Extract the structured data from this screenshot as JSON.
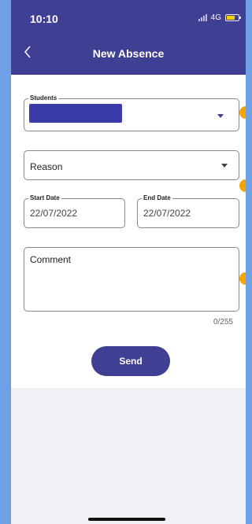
{
  "status_bar": {
    "time": "10:10",
    "network": "4G"
  },
  "header": {
    "title": "New Absence"
  },
  "form": {
    "students": {
      "label": "Students"
    },
    "reason": {
      "placeholder": "Reason"
    },
    "start_date": {
      "label": "Start Date",
      "value": "22/07/2022"
    },
    "end_date": {
      "label": "End Date",
      "value": "22/07/2022"
    },
    "comment": {
      "placeholder": "Comment",
      "counter": "0/255"
    }
  },
  "actions": {
    "send_label": "Send"
  },
  "colors": {
    "primary": "#3f3f94",
    "caret": "#3f3f94",
    "accent_orange": "#f6a500",
    "page_bg": "#6ea0e6"
  }
}
